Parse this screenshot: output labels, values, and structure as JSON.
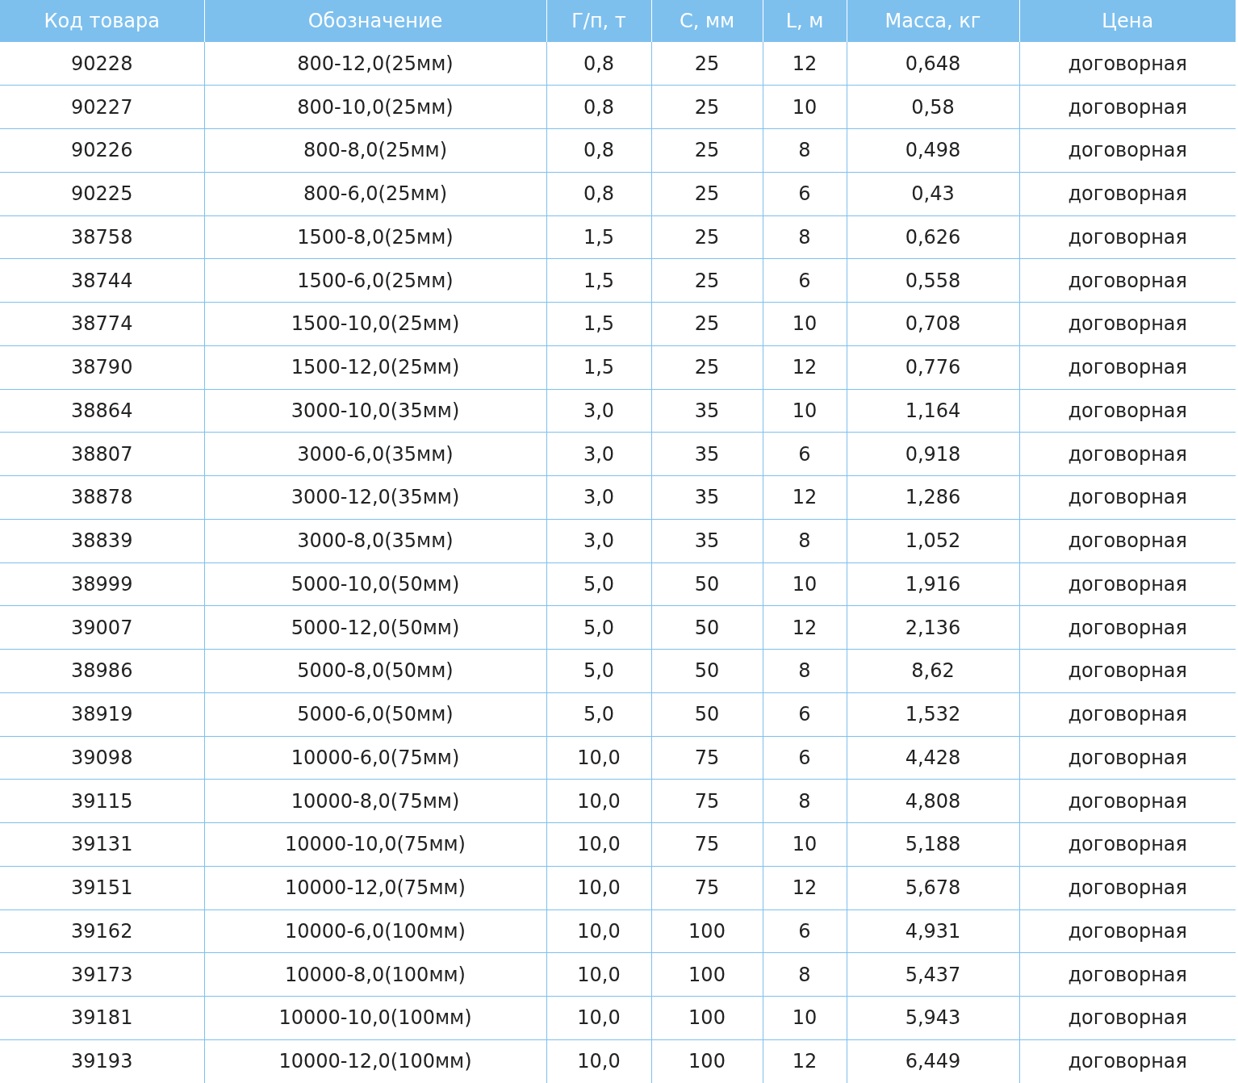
{
  "table": {
    "columns": [
      "Код товара",
      "Обозначение",
      "Г/п, т",
      "С, мм",
      "L, м",
      "Масса, кг",
      "Цена"
    ],
    "rows": [
      [
        "90228",
        "800-12,0(25мм)",
        "0,8",
        "25",
        "12",
        "0,648",
        "договорная"
      ],
      [
        "90227",
        "800-10,0(25мм)",
        "0,8",
        "25",
        "10",
        "0,58",
        "договорная"
      ],
      [
        "90226",
        "800-8,0(25мм)",
        "0,8",
        "25",
        "8",
        "0,498",
        "договорная"
      ],
      [
        "90225",
        "800-6,0(25мм)",
        "0,8",
        "25",
        "6",
        "0,43",
        "договорная"
      ],
      [
        "38758",
        "1500-8,0(25мм)",
        "1,5",
        "25",
        "8",
        "0,626",
        "договорная"
      ],
      [
        "38744",
        "1500-6,0(25мм)",
        "1,5",
        "25",
        "6",
        "0,558",
        "договорная"
      ],
      [
        "38774",
        "1500-10,0(25мм)",
        "1,5",
        "25",
        "10",
        "0,708",
        "договорная"
      ],
      [
        "38790",
        "1500-12,0(25мм)",
        "1,5",
        "25",
        "12",
        "0,776",
        "договорная"
      ],
      [
        "38864",
        "3000-10,0(35мм)",
        "3,0",
        "35",
        "10",
        "1,164",
        "договорная"
      ],
      [
        "38807",
        "3000-6,0(35мм)",
        "3,0",
        "35",
        "6",
        "0,918",
        "договорная"
      ],
      [
        "38878",
        "3000-12,0(35мм)",
        "3,0",
        "35",
        "12",
        "1,286",
        "договорная"
      ],
      [
        "38839",
        "3000-8,0(35мм)",
        "3,0",
        "35",
        "8",
        "1,052",
        "договорная"
      ],
      [
        "38999",
        "5000-10,0(50мм)",
        "5,0",
        "50",
        "10",
        "1,916",
        "договорная"
      ],
      [
        "39007",
        "5000-12,0(50мм)",
        "5,0",
        "50",
        "12",
        "2,136",
        "договорная"
      ],
      [
        "38986",
        "5000-8,0(50мм)",
        "5,0",
        "50",
        "8",
        "8,62",
        "договорная"
      ],
      [
        "38919",
        "5000-6,0(50мм)",
        "5,0",
        "50",
        "6",
        "1,532",
        "договорная"
      ],
      [
        "39098",
        "10000-6,0(75мм)",
        "10,0",
        "75",
        "6",
        "4,428",
        "договорная"
      ],
      [
        "39115",
        "10000-8,0(75мм)",
        "10,0",
        "75",
        "8",
        "4,808",
        "договорная"
      ],
      [
        "39131",
        "10000-10,0(75мм)",
        "10,0",
        "75",
        "10",
        "5,188",
        "договорная"
      ],
      [
        "39151",
        "10000-12,0(75мм)",
        "10,0",
        "75",
        "12",
        "5,678",
        "договорная"
      ],
      [
        "39162",
        "10000-6,0(100мм)",
        "10,0",
        "100",
        "6",
        "4,931",
        "договорная"
      ],
      [
        "39173",
        "10000-8,0(100мм)",
        "10,0",
        "100",
        "8",
        "5,437",
        "договорная"
      ],
      [
        "39181",
        "10000-10,0(100мм)",
        "10,0",
        "100",
        "10",
        "5,943",
        "договорная"
      ],
      [
        "39193",
        "10000-12,0(100мм)",
        "10,0",
        "100",
        "12",
        "6,449",
        "договорная"
      ]
    ]
  }
}
